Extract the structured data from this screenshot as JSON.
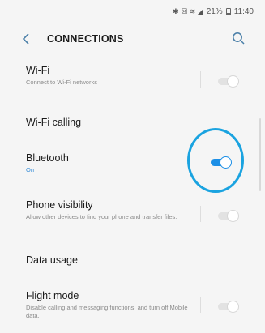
{
  "status_bar": {
    "icons_text": "✱ ☒ ≋ ◢",
    "battery": "21%",
    "time": "11:40"
  },
  "header": {
    "back_icon": "chevron-left-icon",
    "title": "CONNECTIONS",
    "search_icon": "search-icon"
  },
  "rows": [
    {
      "id": "wifi",
      "title": "Wi-Fi",
      "subtitle": "Connect to Wi-Fi networks",
      "toggle": false
    },
    {
      "id": "wifi-calling",
      "title": "Wi-Fi calling"
    },
    {
      "id": "bluetooth",
      "title": "Bluetooth",
      "subtitle": "On",
      "toggle": true
    },
    {
      "id": "phone-visibility",
      "title": "Phone visibility",
      "subtitle": "Allow other devices to find your phone and transfer files.",
      "toggle": false
    },
    {
      "id": "data-usage",
      "title": "Data usage"
    },
    {
      "id": "flight-mode",
      "title": "Flight mode",
      "subtitle": "Disable calling and messaging functions, and turn off Mobile data.",
      "toggle": false
    }
  ],
  "colors": {
    "accent": "#1c8fe6",
    "highlight_ring": "#1aa3e0",
    "back_icon": "#4a7fa8"
  }
}
